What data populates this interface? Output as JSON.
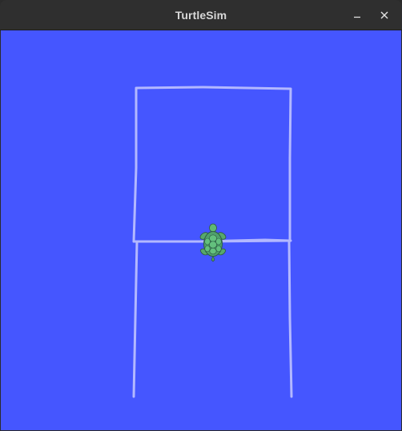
{
  "window": {
    "title": "TurtleSim",
    "controls": {
      "minimize_icon": "minimize-icon",
      "close_icon": "close-icon"
    }
  },
  "canvas": {
    "background_color": "#4556ff",
    "trail_color": "#b3b8ff",
    "turtle_icon": "turtle-icon"
  }
}
